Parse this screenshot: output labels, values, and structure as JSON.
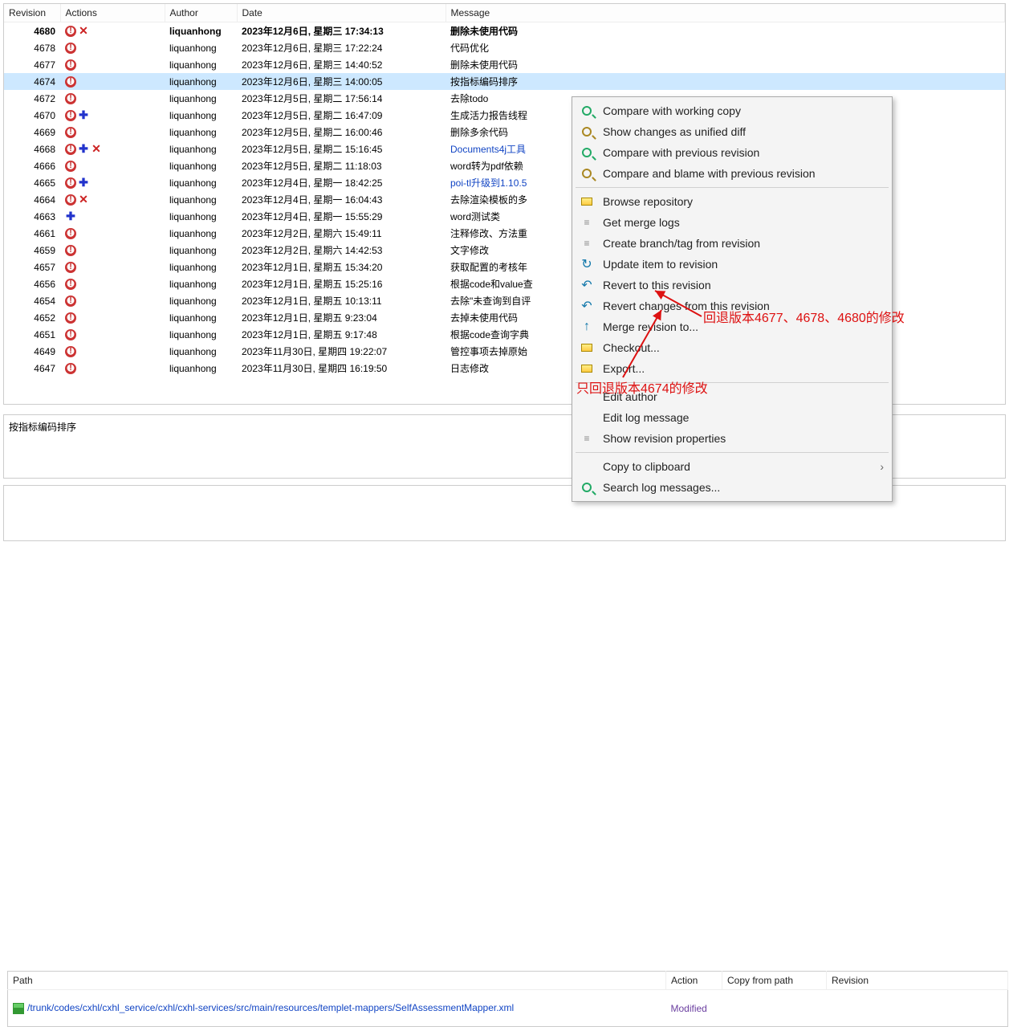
{
  "columns": {
    "revision": "Revision",
    "actions": "Actions",
    "author": "Author",
    "date": "Date",
    "message": "Message"
  },
  "rows": [
    {
      "rev": "4680",
      "au": "liquanhong",
      "dt": "2023年12月6日, 星期三 17:34:13",
      "msg": "删除未使用代码",
      "bold": true,
      "icons": [
        "mod",
        "del"
      ]
    },
    {
      "rev": "4678",
      "au": "liquanhong",
      "dt": "2023年12月6日, 星期三 17:22:24",
      "msg": "代码优化",
      "icons": [
        "mod"
      ]
    },
    {
      "rev": "4677",
      "au": "liquanhong",
      "dt": "2023年12月6日, 星期三 14:40:52",
      "msg": "删除未使用代码",
      "icons": [
        "mod"
      ]
    },
    {
      "rev": "4674",
      "au": "liquanhong",
      "dt": "2023年12月6日, 星期三 14:00:05",
      "msg": "按指标编码排序",
      "sel": true,
      "icons": [
        "mod"
      ]
    },
    {
      "rev": "4672",
      "au": "liquanhong",
      "dt": "2023年12月5日, 星期二 17:56:14",
      "msg": "去除todo",
      "icons": [
        "mod"
      ]
    },
    {
      "rev": "4670",
      "au": "liquanhong",
      "dt": "2023年12月5日, 星期二 16:47:09",
      "msg": "生成活力报告线程",
      "icons": [
        "mod",
        "add"
      ]
    },
    {
      "rev": "4669",
      "au": "liquanhong",
      "dt": "2023年12月5日, 星期二 16:00:46",
      "msg": "删除多余代码",
      "icons": [
        "mod"
      ]
    },
    {
      "rev": "4668",
      "au": "liquanhong",
      "dt": "2023年12月5日, 星期二 15:16:45",
      "msg": "Documents4j工具",
      "link": true,
      "icons": [
        "mod",
        "add",
        "del"
      ]
    },
    {
      "rev": "4666",
      "au": "liquanhong",
      "dt": "2023年12月5日, 星期二 11:18:03",
      "msg": "word转为pdf依赖",
      "icons": [
        "mod"
      ]
    },
    {
      "rev": "4665",
      "au": "liquanhong",
      "dt": "2023年12月4日, 星期一 18:42:25",
      "msg": "poi-tl升级到1.10.5",
      "link": true,
      "icons": [
        "mod",
        "add"
      ]
    },
    {
      "rev": "4664",
      "au": "liquanhong",
      "dt": "2023年12月4日, 星期一 16:04:43",
      "msg": "去除渲染模板的多",
      "icons": [
        "mod",
        "del"
      ]
    },
    {
      "rev": "4663",
      "au": "liquanhong",
      "dt": "2023年12月4日, 星期一 15:55:29",
      "msg": "word测试类",
      "icons": [
        "add"
      ]
    },
    {
      "rev": "4661",
      "au": "liquanhong",
      "dt": "2023年12月2日, 星期六 15:49:11",
      "msg": "注释修改、方法重",
      "icons": [
        "mod"
      ]
    },
    {
      "rev": "4659",
      "au": "liquanhong",
      "dt": "2023年12月2日, 星期六 14:42:53",
      "msg": "文字修改",
      "icons": [
        "mod"
      ]
    },
    {
      "rev": "4657",
      "au": "liquanhong",
      "dt": "2023年12月1日, 星期五 15:34:20",
      "msg": "获取配置的考核年",
      "icons": [
        "mod"
      ]
    },
    {
      "rev": "4656",
      "au": "liquanhong",
      "dt": "2023年12月1日, 星期五 15:25:16",
      "msg": "根据code和value查",
      "icons": [
        "mod"
      ]
    },
    {
      "rev": "4654",
      "au": "liquanhong",
      "dt": "2023年12月1日, 星期五 10:13:11",
      "msg": "去除\"未查询到自评",
      "icons": [
        "mod"
      ]
    },
    {
      "rev": "4652",
      "au": "liquanhong",
      "dt": "2023年12月1日, 星期五 9:23:04",
      "msg": "去掉未使用代码",
      "icons": [
        "mod"
      ]
    },
    {
      "rev": "4651",
      "au": "liquanhong",
      "dt": "2023年12月1日, 星期五 9:17:48",
      "msg": "根据code查询字典",
      "icons": [
        "mod"
      ]
    },
    {
      "rev": "4649",
      "au": "liquanhong",
      "dt": "2023年11月30日, 星期四 19:22:07",
      "msg": "管控事项去掉原始",
      "icons": [
        "mod"
      ]
    },
    {
      "rev": "4647",
      "au": "liquanhong",
      "dt": "2023年11月30日, 星期四 16:19:50",
      "msg": "日志修改",
      "icons": [
        "mod"
      ]
    }
  ],
  "selected_message": "按指标编码排序",
  "paths": {
    "headers": {
      "path": "Path",
      "action": "Action",
      "copy": "Copy from path",
      "rev": "Revision"
    },
    "row": {
      "path": "/trunk/codes/cxhl/cxhl_service/cxhl/cxhl-services/src/main/resources/templet-mappers/SelfAssessmentMapper.xml",
      "action": "Modified"
    }
  },
  "menu": [
    {
      "t": "Compare with working copy",
      "i": "mag"
    },
    {
      "t": "Show changes as unified diff",
      "i": "diff1"
    },
    {
      "t": "Compare with previous revision",
      "i": "mag"
    },
    {
      "t": "Compare and blame with previous revision",
      "i": "diff1"
    },
    {
      "sep": true
    },
    {
      "t": "Browse repository",
      "i": "exp"
    },
    {
      "t": "Get merge logs",
      "i": "txt"
    },
    {
      "t": "Create branch/tag from revision",
      "i": "txt"
    },
    {
      "t": "Update item to revision",
      "i": "rev",
      "g": "↻"
    },
    {
      "t": "Revert to this revision",
      "i": "rev",
      "g": "↶"
    },
    {
      "t": "Revert changes from this revision",
      "i": "rev",
      "g": "↶"
    },
    {
      "t": "Merge revision to...",
      "i": "rev",
      "g": "↑"
    },
    {
      "t": "Checkout...",
      "i": "exp"
    },
    {
      "t": "Export...",
      "i": "exp"
    },
    {
      "sep": true
    },
    {
      "t": "Edit author"
    },
    {
      "t": "Edit log message"
    },
    {
      "t": "Show revision properties",
      "i": "txt"
    },
    {
      "sep": true
    },
    {
      "t": "Copy to clipboard",
      "sub": "›"
    },
    {
      "t": "Search log messages...",
      "i": "mag"
    }
  ],
  "annotations": {
    "a1": "回退版本4677、4678、4680的修改",
    "a2": "只回退版本4674的修改"
  }
}
